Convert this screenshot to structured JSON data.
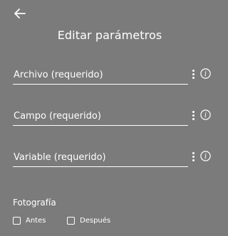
{
  "header": {
    "back_icon": "arrow-left-icon",
    "title": "Editar parámetros"
  },
  "fields": [
    {
      "placeholder": "Archivo (requerido)",
      "value": "",
      "menu_icon": "vertical-dots-icon",
      "info_icon": "info-circle-icon"
    },
    {
      "placeholder": "Campo (requerido)",
      "value": "",
      "menu_icon": "vertical-dots-icon",
      "info_icon": "info-circle-icon"
    },
    {
      "placeholder": "Variable (requerido)",
      "value": "",
      "menu_icon": "vertical-dots-icon",
      "info_icon": "info-circle-icon"
    }
  ],
  "photo_section": {
    "label": "Fotografía",
    "options": [
      {
        "label": "Antes",
        "checked": false
      },
      {
        "label": "Después",
        "checked": false
      }
    ]
  },
  "colors": {
    "background": "#7b7b7b",
    "foreground": "#ffffff"
  }
}
